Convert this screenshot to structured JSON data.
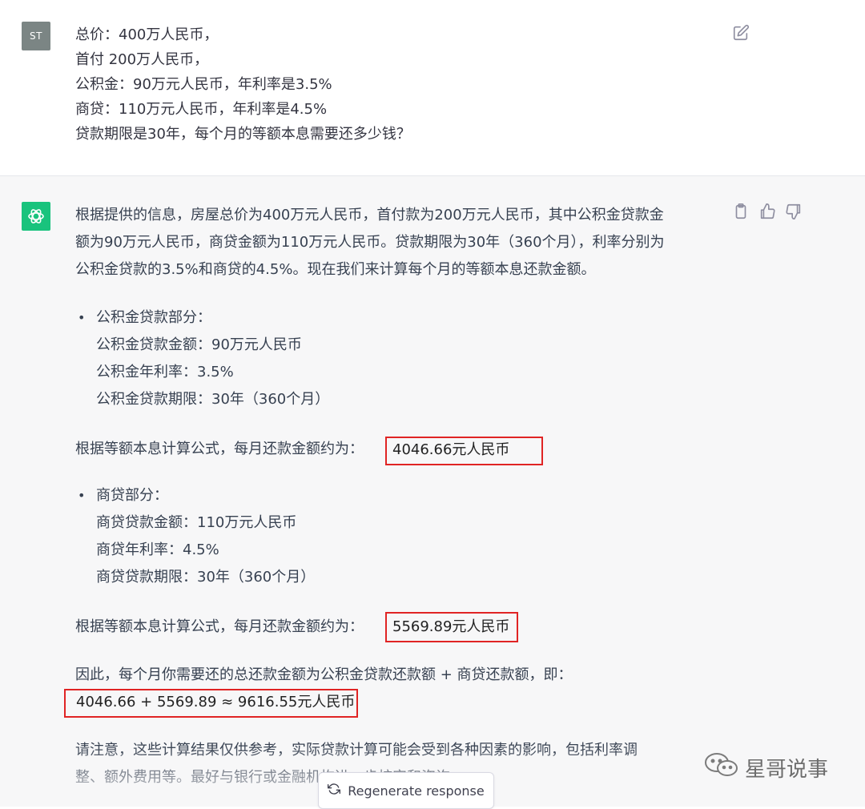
{
  "user": {
    "avatar_text": "ST",
    "lines": [
      "总价：400万人民币，",
      "首付 200万人民币，",
      "公积金：90万元人民币，年利率是3.5%",
      "商贷：110万元人民币，年利率是4.5%",
      "贷款期限是30年，每个月的等额本息需要还多少钱？"
    ]
  },
  "assistant": {
    "intro": [
      "根据提供的信息，房屋总价为400万元人民币，首付款为200万元人民币，其中公积金贷款金",
      "额为90万元人民币，商贷金额为110万元人民币。贷款期限为30年（360个月），利率分别为",
      "公积金贷款的3.5%和商贷的4.5%。现在我们来计算每个月的等额本息还款金额。"
    ],
    "section1": {
      "head": "公积金贷款部分：",
      "items": [
        "公积金贷款金额：90万元人民币",
        "公积金年利率：3.5%",
        "公积金贷款期限：30年（360个月）"
      ],
      "result_prefix": "根据等额本息计算公式，每月还款金额约为：",
      "result_value": "4046.66元人民币"
    },
    "section2": {
      "head": "商贷部分：",
      "items": [
        "商贷贷款金额：110万元人民币",
        "商贷年利率：4.5%",
        "商贷贷款期限：30年（360个月）"
      ],
      "result_prefix": "根据等额本息计算公式，每月还款金额约为：",
      "result_value": "5569.89元人民币"
    },
    "total_line": "因此，每个月你需要还的总还款金额为公积金贷款还款额 + 商贷还款额，即：",
    "total_value": "4046.66 + 5569.89 ≈ 9616.55元人民币",
    "note": [
      "请注意，这些计算结果仅供参考，实际贷款计算可能会受到各种因素的影响，包括利率调",
      "整、额外费用等。最好与银行或金融机构进一步核实和咨询。"
    ]
  },
  "regenerate_label": "Regenerate response",
  "watermark_text": "星哥说事",
  "colors": {
    "user_avatar": "#7b8584",
    "gpt_avatar": "#19c37d",
    "highlight_box": "#e02424"
  }
}
